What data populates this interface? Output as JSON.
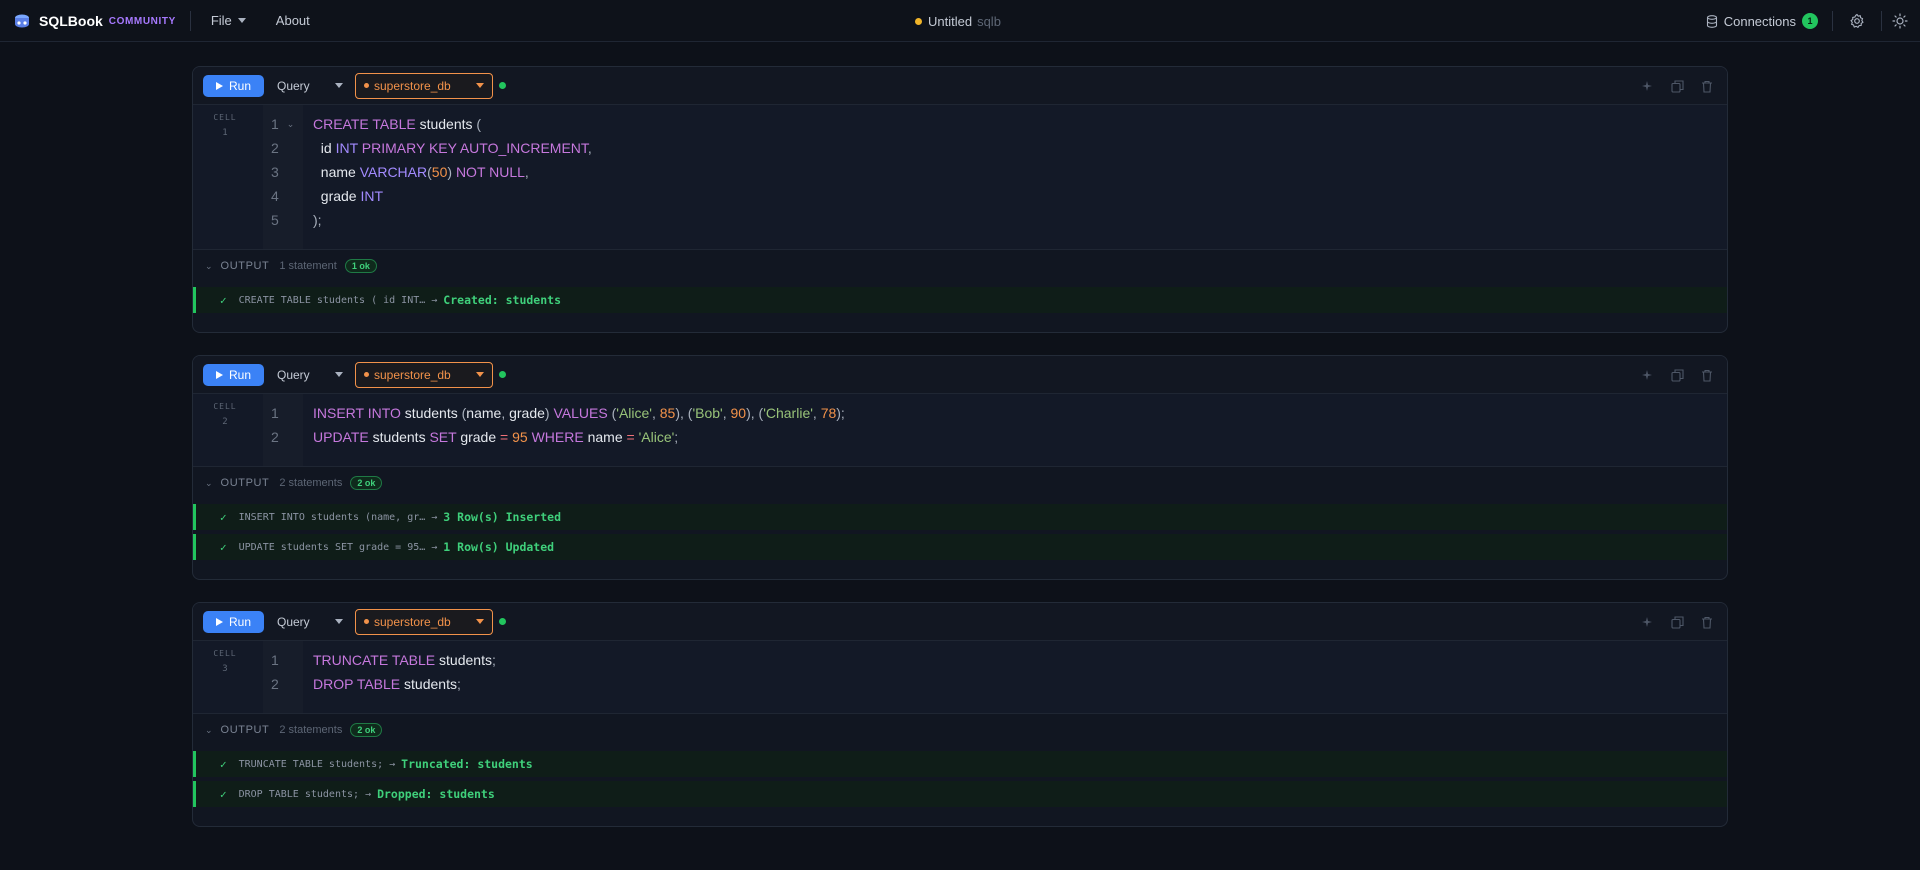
{
  "app": {
    "name": "SQLBook",
    "edition": "COMMUNITY"
  },
  "menu": {
    "file": "File",
    "about": "About"
  },
  "document": {
    "name": "Untitled",
    "ext": "sqlb"
  },
  "connections": {
    "label": "Connections",
    "count": "1"
  },
  "cells": [
    {
      "run_label": "Run",
      "mode": "Query",
      "database": "superstore_db",
      "label": "CELL",
      "number": "1",
      "line_numbers": [
        "1",
        "2",
        "3",
        "4",
        "5"
      ],
      "output_label": "OUTPUT",
      "statement_count": "1 statement",
      "ok_badge": "1 ok",
      "results": [
        {
          "statement": "CREATE TABLE students ( id INT…",
          "result": "Created: students"
        }
      ]
    },
    {
      "run_label": "Run",
      "mode": "Query",
      "database": "superstore_db",
      "label": "CELL",
      "number": "2",
      "line_numbers": [
        "1",
        "2"
      ],
      "output_label": "OUTPUT",
      "statement_count": "2 statements",
      "ok_badge": "2 ok",
      "results": [
        {
          "statement": "INSERT INTO students (name, gr…",
          "result": "3 Row(s) Inserted"
        },
        {
          "statement": "UPDATE students SET grade = 95…",
          "result": "1 Row(s) Updated"
        }
      ]
    },
    {
      "run_label": "Run",
      "mode": "Query",
      "database": "superstore_db",
      "label": "CELL",
      "number": "3",
      "line_numbers": [
        "1",
        "2"
      ],
      "output_label": "OUTPUT",
      "statement_count": "2 statements",
      "ok_badge": "2 ok",
      "results": [
        {
          "statement": "TRUNCATE TABLE students;",
          "result": "Truncated: students"
        },
        {
          "statement": "DROP TABLE students;",
          "result": "Dropped: students"
        }
      ]
    }
  ],
  "code": {
    "c1": [
      [
        [
          "kw",
          "CREATE TABLE"
        ],
        [
          "",
          " students "
        ],
        [
          "pu",
          "("
        ]
      ],
      [
        [
          "",
          "  id "
        ],
        [
          "ty",
          "INT"
        ],
        [
          "",
          " "
        ],
        [
          "kw",
          "PRIMARY KEY AUTO_INCREMENT"
        ],
        [
          "pu",
          ","
        ]
      ],
      [
        [
          "",
          "  name "
        ],
        [
          "ty",
          "VARCHAR"
        ],
        [
          "pu",
          "("
        ],
        [
          "nm",
          "50"
        ],
        [
          "pu",
          ")"
        ],
        [
          "",
          " "
        ],
        [
          "kw",
          "NOT NULL"
        ],
        [
          "pu",
          ","
        ]
      ],
      [
        [
          "",
          "  grade "
        ],
        [
          "ty",
          "INT"
        ]
      ],
      [
        [
          "pu",
          ");"
        ]
      ]
    ],
    "c2": [
      [
        [
          "kw",
          "INSERT INTO"
        ],
        [
          "",
          " students "
        ],
        [
          "pu",
          "("
        ],
        [
          "",
          "name"
        ],
        [
          "pu",
          ","
        ],
        [
          "",
          " grade"
        ],
        [
          "pu",
          ")"
        ],
        [
          "",
          " "
        ],
        [
          "kw",
          "VALUES"
        ],
        [
          "",
          " "
        ],
        [
          "pu",
          "("
        ],
        [
          "st",
          "'Alice'"
        ],
        [
          "pu",
          ","
        ],
        [
          "",
          " "
        ],
        [
          "nm",
          "85"
        ],
        [
          "pu",
          "),"
        ],
        [
          "",
          " "
        ],
        [
          "pu",
          "("
        ],
        [
          "st",
          "'Bob'"
        ],
        [
          "pu",
          ","
        ],
        [
          "",
          " "
        ],
        [
          "nm",
          "90"
        ],
        [
          "pu",
          "),"
        ],
        [
          "",
          " "
        ],
        [
          "pu",
          "("
        ],
        [
          "st",
          "'Charlie'"
        ],
        [
          "pu",
          ","
        ],
        [
          "",
          " "
        ],
        [
          "nm",
          "78"
        ],
        [
          "pu",
          ");"
        ]
      ],
      [
        [
          "kw",
          "UPDATE"
        ],
        [
          "",
          " students "
        ],
        [
          "kw",
          "SET"
        ],
        [
          "",
          " grade "
        ],
        [
          "op",
          "="
        ],
        [
          "",
          " "
        ],
        [
          "nm",
          "95"
        ],
        [
          "",
          " "
        ],
        [
          "kw",
          "WHERE"
        ],
        [
          "",
          " name "
        ],
        [
          "op",
          "="
        ],
        [
          "",
          " "
        ],
        [
          "st",
          "'Alice'"
        ],
        [
          "pu",
          ";"
        ]
      ]
    ],
    "c3": [
      [
        [
          "kw",
          "TRUNCATE TABLE"
        ],
        [
          "",
          " students"
        ],
        [
          "pu",
          ";"
        ]
      ],
      [
        [
          "kw",
          "DROP TABLE"
        ],
        [
          "",
          " students"
        ],
        [
          "pu",
          ";"
        ]
      ]
    ]
  },
  "icons": {
    "logo": "sqlbook-logo-icon",
    "connections": "database-icon",
    "settings": "gear-icon",
    "theme": "sun-icon",
    "run": "play-icon",
    "ai": "sparkle-icon",
    "duplicate": "copy-icon",
    "delete": "trash-icon"
  },
  "colors": {
    "accent": "#3b82f6",
    "brand_tag": "#a779ff",
    "db": "#f2924a",
    "success": "#22c55e",
    "unsaved": "#f0b429"
  }
}
